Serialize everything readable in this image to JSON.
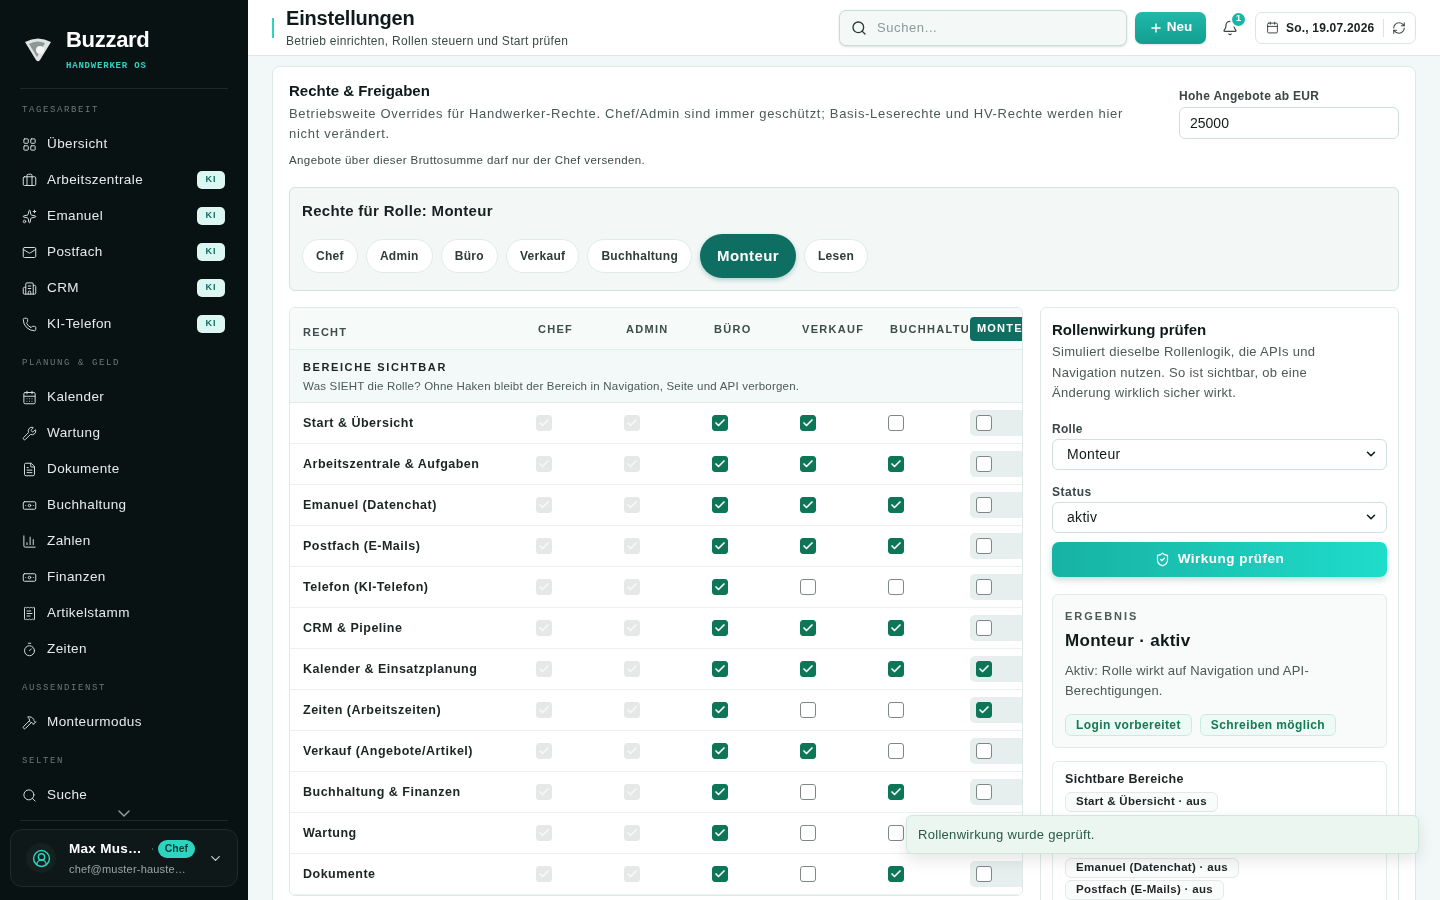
{
  "sidebar": {
    "brand": {
      "name": "Buzzard",
      "tagline": "HANDWERKER OS"
    },
    "sections": [
      {
        "title": "TAGESARBEIT",
        "items": [
          {
            "label": "Übersicht",
            "selected": false
          },
          {
            "label": "Arbeitszentrale",
            "badge": "KI",
            "selected": false
          },
          {
            "label": "Emanuel",
            "badge": "KI",
            "selected": false
          },
          {
            "label": "Postfach",
            "badge": "KI",
            "selected": false
          },
          {
            "label": "CRM",
            "badge": "KI",
            "selected": false
          },
          {
            "label": "KI-Telefon",
            "badge": "KI",
            "selected": false
          }
        ]
      },
      {
        "title": "PLANUNG & GELD",
        "items": [
          {
            "label": "Kalender",
            "selected": false
          },
          {
            "label": "Wartung",
            "selected": false
          },
          {
            "label": "Dokumente",
            "selected": false
          },
          {
            "label": "Buchhaltung",
            "selected": false
          },
          {
            "label": "Zahlen",
            "selected": false
          },
          {
            "label": "Finanzen",
            "selected": false
          },
          {
            "label": "Artikelstamm",
            "selected": false
          },
          {
            "label": "Zeiten",
            "selected": false
          }
        ]
      },
      {
        "title": "AUSSENDIENST",
        "items": [
          {
            "label": "Monteurmodus",
            "selected": false
          }
        ]
      },
      {
        "title": "SELTEN",
        "items": [
          {
            "label": "Suche",
            "selected": false
          }
        ]
      }
    ],
    "user": {
      "name": "Max Mus…",
      "role": "Chef",
      "email": "chef@muster-hauste…"
    }
  },
  "header": {
    "title": "Einstellungen",
    "subtitle": "Betrieb einrichten, Rollen steuern und Start prüfen",
    "search": {
      "placeholder": "Suchen..."
    },
    "new_button": "Neu",
    "notifications": "1",
    "date": "So., 19.07.2026"
  },
  "permissions": {
    "title": "Rechte & Freigaben",
    "description": "Betriebsweite Overrides für Handwerker-Rechte. Chef/Admin sind immer geschützt; Basis-Leserechte und HV-Rechte werden hier nicht verändert.",
    "note": "Angebote über dieser Bruttosumme darf nur der Chef versenden.",
    "threshold": {
      "label": "Hohe Angebote ab EUR",
      "value": "25000"
    },
    "role_picker": {
      "title": "Rechte für Rolle: Monteur",
      "roles": [
        {
          "label": "Chef",
          "selected": false
        },
        {
          "label": "Admin",
          "selected": false
        },
        {
          "label": "Büro",
          "selected": false
        },
        {
          "label": "Verkauf",
          "selected": false
        },
        {
          "label": "Buchhaltung",
          "selected": false
        },
        {
          "label": "Monteur",
          "selected": true
        },
        {
          "label": "Lesen",
          "selected": false
        }
      ]
    },
    "table": {
      "first_column": "RECHT",
      "columns": [
        {
          "label": "CHEF",
          "selected": false
        },
        {
          "label": "ADMIN",
          "selected": false
        },
        {
          "label": "BÜRO",
          "selected": false
        },
        {
          "label": "VERKAUF",
          "selected": false
        },
        {
          "label": "BUCHHALTU",
          "selected": false
        },
        {
          "label": "MONTE",
          "selected": true
        }
      ],
      "section": {
        "title": "BEREICHE SICHTBAR",
        "description": "Was SIEHT die Rolle? Ohne Haken bleibt der Bereich in Navigation, Seite und API verborgen."
      },
      "rows": [
        {
          "label": "Start & Übersicht",
          "cells": [
            {
              "checked": true,
              "disabled": true
            },
            {
              "checked": true,
              "disabled": true
            },
            {
              "checked": true,
              "disabled": false
            },
            {
              "checked": true,
              "disabled": false
            },
            {
              "checked": false,
              "disabled": false
            },
            {
              "checked": false,
              "disabled": false
            }
          ]
        },
        {
          "label": "Arbeitszentrale & Aufgaben",
          "cells": [
            {
              "checked": true,
              "disabled": true
            },
            {
              "checked": true,
              "disabled": true
            },
            {
              "checked": true,
              "disabled": false
            },
            {
              "checked": true,
              "disabled": false
            },
            {
              "checked": true,
              "disabled": false
            },
            {
              "checked": false,
              "disabled": false
            }
          ]
        },
        {
          "label": "Emanuel (Datenchat)",
          "cells": [
            {
              "checked": true,
              "disabled": true
            },
            {
              "checked": true,
              "disabled": true
            },
            {
              "checked": true,
              "disabled": false
            },
            {
              "checked": true,
              "disabled": false
            },
            {
              "checked": true,
              "disabled": false
            },
            {
              "checked": false,
              "disabled": false
            }
          ]
        },
        {
          "label": "Postfach (E-Mails)",
          "cells": [
            {
              "checked": true,
              "disabled": true
            },
            {
              "checked": true,
              "disabled": true
            },
            {
              "checked": true,
              "disabled": false
            },
            {
              "checked": true,
              "disabled": false
            },
            {
              "checked": true,
              "disabled": false
            },
            {
              "checked": false,
              "disabled": false
            }
          ]
        },
        {
          "label": "Telefon (KI-Telefon)",
          "cells": [
            {
              "checked": true,
              "disabled": true
            },
            {
              "checked": true,
              "disabled": true
            },
            {
              "checked": true,
              "disabled": false
            },
            {
              "checked": false,
              "disabled": false
            },
            {
              "checked": false,
              "disabled": false
            },
            {
              "checked": false,
              "disabled": false
            }
          ]
        },
        {
          "label": "CRM & Pipeline",
          "cells": [
            {
              "checked": true,
              "disabled": true
            },
            {
              "checked": true,
              "disabled": true
            },
            {
              "checked": true,
              "disabled": false
            },
            {
              "checked": true,
              "disabled": false
            },
            {
              "checked": true,
              "disabled": false
            },
            {
              "checked": false,
              "disabled": false
            }
          ]
        },
        {
          "label": "Kalender & Einsatzplanung",
          "cells": [
            {
              "checked": true,
              "disabled": true
            },
            {
              "checked": true,
              "disabled": true
            },
            {
              "checked": true,
              "disabled": false
            },
            {
              "checked": true,
              "disabled": false
            },
            {
              "checked": true,
              "disabled": false
            },
            {
              "checked": true,
              "disabled": false
            }
          ]
        },
        {
          "label": "Zeiten (Arbeitszeiten)",
          "cells": [
            {
              "checked": true,
              "disabled": true
            },
            {
              "checked": true,
              "disabled": true
            },
            {
              "checked": true,
              "disabled": false
            },
            {
              "checked": false,
              "disabled": false
            },
            {
              "checked": false,
              "disabled": false
            },
            {
              "checked": true,
              "disabled": false
            }
          ]
        },
        {
          "label": "Verkauf (Angebote/Artikel)",
          "cells": [
            {
              "checked": true,
              "disabled": true
            },
            {
              "checked": true,
              "disabled": true
            },
            {
              "checked": true,
              "disabled": false
            },
            {
              "checked": true,
              "disabled": false
            },
            {
              "checked": false,
              "disabled": false
            },
            {
              "checked": false,
              "disabled": false
            }
          ]
        },
        {
          "label": "Buchhaltung & Finanzen",
          "cells": [
            {
              "checked": true,
              "disabled": true
            },
            {
              "checked": true,
              "disabled": true
            },
            {
              "checked": true,
              "disabled": false
            },
            {
              "checked": false,
              "disabled": false
            },
            {
              "checked": true,
              "disabled": false
            },
            {
              "checked": false,
              "disabled": false
            }
          ]
        },
        {
          "label": "Wartung",
          "cells": [
            {
              "checked": true,
              "disabled": true
            },
            {
              "checked": true,
              "disabled": true
            },
            {
              "checked": true,
              "disabled": false
            },
            {
              "checked": false,
              "disabled": false
            },
            {
              "checked": false,
              "disabled": false
            }
          ]
        },
        {
          "label": "Dokumente",
          "cells": [
            {
              "checked": true,
              "disabled": true
            },
            {
              "checked": true,
              "disabled": true
            },
            {
              "checked": true,
              "disabled": false
            },
            {
              "checked": false,
              "disabled": false
            },
            {
              "checked": true,
              "disabled": false
            },
            {
              "checked": false,
              "disabled": false
            }
          ]
        }
      ]
    }
  },
  "check_panel": {
    "title": "Rollenwirkung prüfen",
    "description": "Simuliert dieselbe Rollenlogik, die APIs und Navigation nutzen. So ist sichtbar, ob eine Änderung wirklich sicher wirkt.",
    "role": {
      "label": "Rolle",
      "value": "Monteur"
    },
    "status": {
      "label": "Status",
      "value": "aktiv"
    },
    "button": "Wirkung prüfen",
    "result": {
      "eyebrow": "ERGEBNIS",
      "title": "Monteur · aktiv",
      "description": "Aktiv: Rolle wirkt auf Navigation und API-Berechtigungen.",
      "tags": [
        "Login vorbereitet",
        "Schreiben möglich"
      ]
    },
    "visible_areas": {
      "title": "Sichtbare Bereiche",
      "chips": [
        "Start & Übersicht · aus",
        "Emanuel (Datenchat) · aus",
        "Postfach (E-Mails) · aus"
      ]
    }
  },
  "toast": "Rollenwirkung wurde geprüft."
}
